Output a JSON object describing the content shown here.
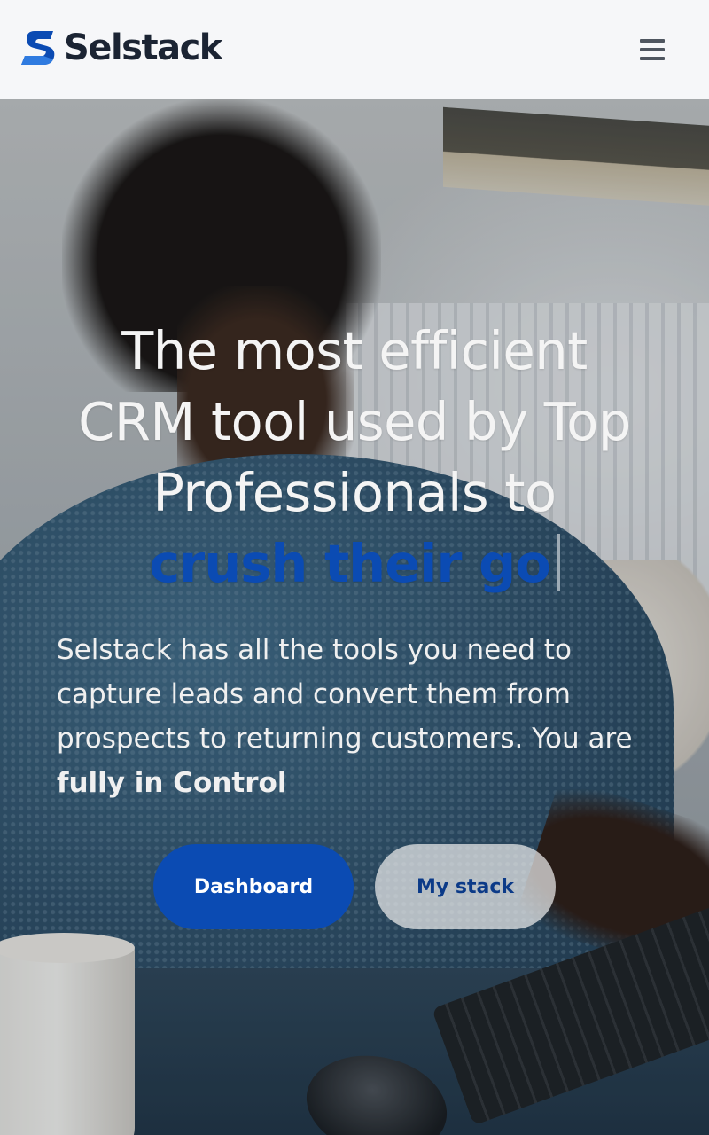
{
  "header": {
    "logo_text": "Selstack",
    "menu_icon": "hamburger-menu-icon"
  },
  "hero": {
    "headline_lines": [
      "The most efficient",
      "CRM tool used by Top",
      "Professionals to"
    ],
    "headline_accent": "crush their go",
    "description_text": "Selstack has all the tools you need to capture leads and convert them from prospects to returning customers. You are",
    "description_emphasis": "fully in Control",
    "primary_button_label": "Dashboard",
    "secondary_button_label": "My stack"
  },
  "colors": {
    "accent": "#0b4bb3",
    "header_bg": "#f6f7f9",
    "logo_text": "#1b2433",
    "secondary_button_text": "#0b3a88"
  }
}
